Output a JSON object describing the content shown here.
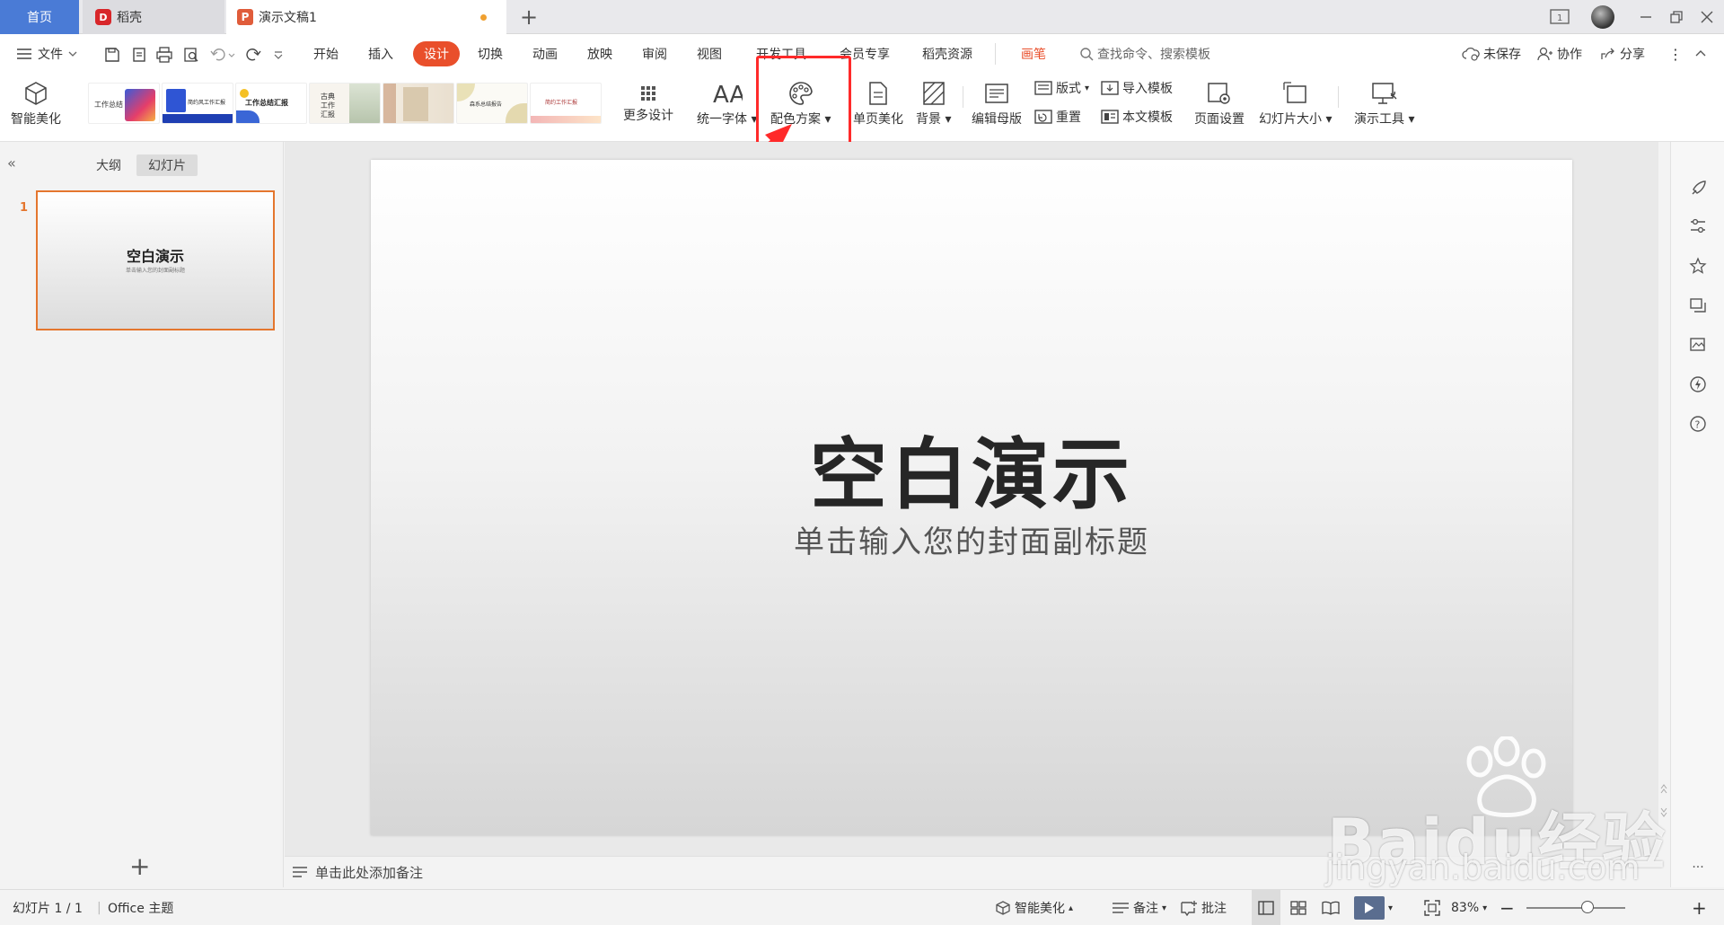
{
  "tabs": {
    "home": "首页",
    "daoke": "稻壳",
    "document": "演示文稿1"
  },
  "menu": {
    "file": "文件",
    "items": [
      "开始",
      "插入",
      "设计",
      "切换",
      "动画",
      "放映",
      "审阅",
      "视图",
      "开发工具",
      "会员专享",
      "稻壳资源"
    ],
    "active": "设计",
    "brush": "画笔",
    "search_placeholder": "查找命令、搜索模板",
    "unsaved": "未保存",
    "collab": "协作",
    "share": "分享"
  },
  "ribbon": {
    "smart_beautify": "智能美化",
    "more_design": "更多设计",
    "unified_font": "统一字体",
    "color_scheme": "配色方案",
    "single_page": "单页美化",
    "background": "背景",
    "edit_master": "编辑母版",
    "layout": "版式",
    "reset": "重置",
    "import_template": "导入模板",
    "this_template": "本文模板",
    "page_setup": "页面设置",
    "slide_size": "幻灯片大小",
    "presentation_tools": "演示工具",
    "thumbs": [
      "工作总结",
      "简约风工作汇报",
      "工作总结汇报",
      "古典工作汇报",
      "",
      "森系总结报告",
      "简约工作汇报"
    ]
  },
  "leftpanel": {
    "outline_tab": "大纲",
    "slides_tab": "幻灯片",
    "slide_number": "1",
    "thumb_title": "空白演示",
    "thumb_sub": "单击输入您的封面副标题",
    "add": "+"
  },
  "slide": {
    "title": "空白演示",
    "subtitle": "单击输入您的封面副标题"
  },
  "notes_placeholder": "单击此处添加备注",
  "status": {
    "slide_count": "幻灯片 1 / 1",
    "theme": "Office 主题",
    "smart_beautify": "智能美化",
    "notes": "备注",
    "comments": "批注",
    "zoom": "83%",
    "zoom_fraction": 0.62
  },
  "watermark": {
    "brand": "Baidu经验",
    "url": "jingyan.baidu.com"
  },
  "colors": {
    "accent": "#e94f2b",
    "home_tab": "#4a7bd6",
    "highlight": "#ff2a2a",
    "thumb_border": "#e4762e"
  }
}
